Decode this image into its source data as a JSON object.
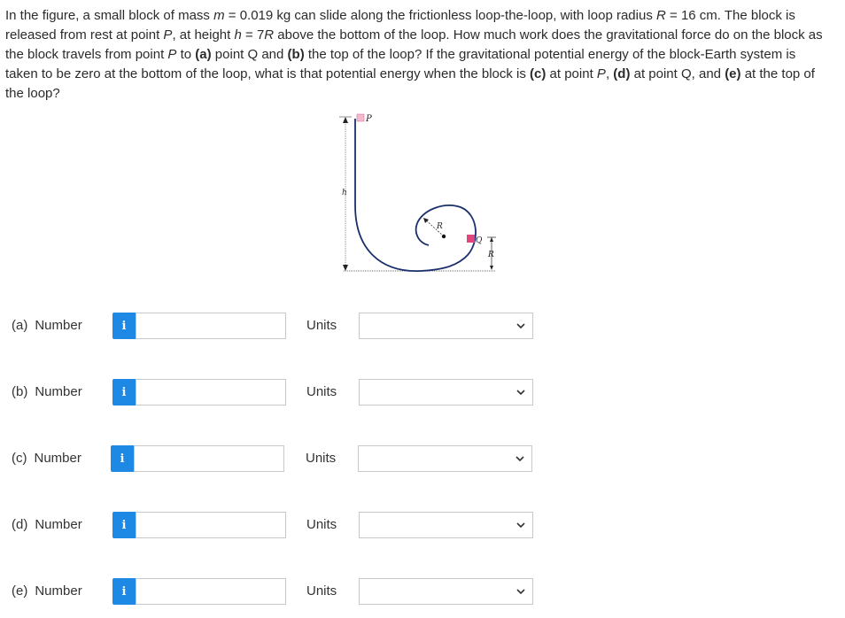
{
  "question": {
    "intro": "In the figure, a small block of mass ",
    "m_sym": "m",
    "m_val": " = 0.019 kg can slide along the frictionless loop-the-loop, with loop radius ",
    "R_sym": "R",
    "R_val": " = 16 cm. The block is released from rest at point ",
    "P1": "P",
    "t1": ", at height ",
    "h_sym": "h",
    "h_val": " = 7",
    "R_sym2": "R",
    "t2": " above the bottom of the loop. How much work does the gravitational force do on the block as the block travels from point ",
    "P2": "P",
    "t3": " to ",
    "a_tag": "(a)",
    "t4": " point Q and ",
    "b_tag": "(b)",
    "t5": " the top of the loop? If the gravitational potential energy of the block-Earth system is taken to be zero at the bottom of the loop, what is that potential energy when the block is ",
    "c_tag": "(c)",
    "t6": " at point ",
    "P3": "P",
    "t7": ", ",
    "d_tag": "(d)",
    "t8": " at point Q, and ",
    "e_tag": "(e)",
    "t9": " at the top of the loop?"
  },
  "figure": {
    "label_P": "P",
    "label_h": "h",
    "label_R_loop": "R",
    "label_Q": "Q",
    "label_R_side": "R",
    "block_color": "#e0467c"
  },
  "rows": [
    {
      "tag": "(a)",
      "word": "Number",
      "info": "i",
      "value": "",
      "units_label": "Units",
      "units_value": ""
    },
    {
      "tag": "(b)",
      "word": "Number",
      "info": "i",
      "value": "",
      "units_label": "Units",
      "units_value": ""
    },
    {
      "tag": "(c)",
      "word": "Number",
      "info": "i",
      "value": "",
      "units_label": "Units",
      "units_value": ""
    },
    {
      "tag": "(d)",
      "word": "Number",
      "info": "i",
      "value": "",
      "units_label": "Units",
      "units_value": ""
    },
    {
      "tag": "(e)",
      "word": "Number",
      "info": "i",
      "value": "",
      "units_label": "Units",
      "units_value": ""
    }
  ],
  "colors": {
    "info_button": "#1e88e5",
    "input_border": "#c8c8c8"
  }
}
